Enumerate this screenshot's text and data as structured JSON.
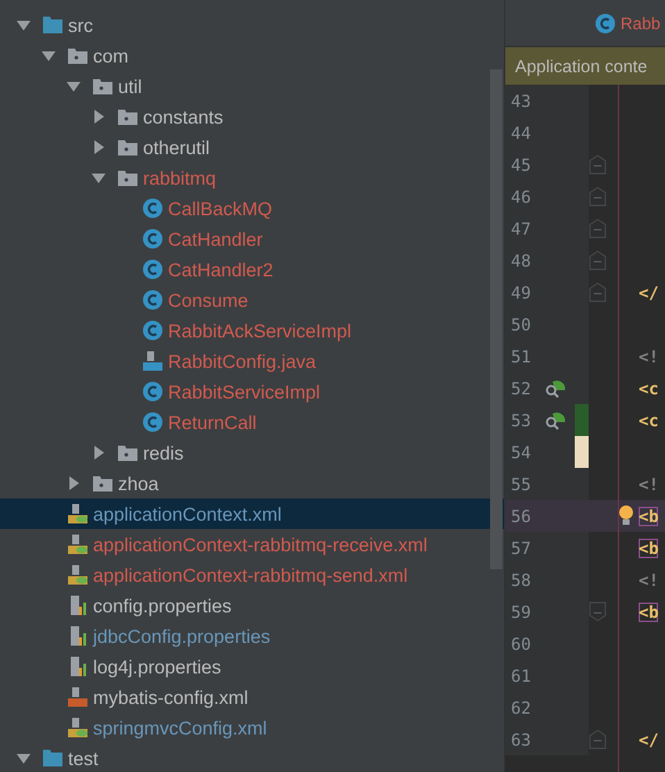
{
  "project_tree": [
    {
      "label": "src",
      "kind": "source-folder",
      "color": "#bbbbbb",
      "expanded": true,
      "selected": false,
      "children": [
        {
          "label": "com",
          "kind": "package",
          "color": "#bbbbbb",
          "expanded": true,
          "selected": false,
          "children": [
            {
              "label": "util",
              "kind": "package",
              "color": "#bbbbbb",
              "expanded": true,
              "selected": false,
              "children": [
                {
                  "label": "constants",
                  "kind": "package",
                  "color": "#bbbbbb",
                  "expanded": false,
                  "selected": false
                },
                {
                  "label": "otherutil",
                  "kind": "package",
                  "color": "#bbbbbb",
                  "expanded": false,
                  "selected": false
                },
                {
                  "label": "rabbitmq",
                  "kind": "package",
                  "color": "#d25a4f",
                  "expanded": true,
                  "selected": false,
                  "children": [
                    {
                      "label": "CallBackMQ",
                      "kind": "class",
                      "color": "#d25a4f",
                      "selected": false
                    },
                    {
                      "label": "CatHandler",
                      "kind": "class",
                      "color": "#d25a4f",
                      "selected": false
                    },
                    {
                      "label": "CatHandler2",
                      "kind": "class",
                      "color": "#d25a4f",
                      "selected": false
                    },
                    {
                      "label": "Consume",
                      "kind": "class",
                      "color": "#d25a4f",
                      "selected": false
                    },
                    {
                      "label": "RabbitAckServiceImpl",
                      "kind": "class",
                      "color": "#d25a4f",
                      "selected": false
                    },
                    {
                      "label": "RabbitConfig.java",
                      "kind": "java",
                      "color": "#d25a4f",
                      "selected": false
                    },
                    {
                      "label": "RabbitServiceImpl",
                      "kind": "class",
                      "color": "#d25a4f",
                      "selected": false
                    },
                    {
                      "label": "ReturnCall",
                      "kind": "class",
                      "color": "#d25a4f",
                      "selected": false
                    }
                  ]
                },
                {
                  "label": "redis",
                  "kind": "package",
                  "color": "#bbbbbb",
                  "expanded": false,
                  "selected": false
                }
              ]
            },
            {
              "label": "zhoa",
              "kind": "package",
              "color": "#bbbbbb",
              "expanded": false,
              "selected": false
            }
          ]
        },
        {
          "label": "applicationContext.xml",
          "kind": "spring-xml",
          "color": "#6897bb",
          "selected": true
        },
        {
          "label": "applicationContext-rabbitmq-receive.xml",
          "kind": "spring-xml",
          "color": "#d25a4f",
          "selected": false
        },
        {
          "label": "applicationContext-rabbitmq-send.xml",
          "kind": "spring-xml",
          "color": "#d25a4f",
          "selected": false
        },
        {
          "label": "config.properties",
          "kind": "properties",
          "color": "#bbbbbb",
          "selected": false
        },
        {
          "label": "jdbcConfig.properties",
          "kind": "properties",
          "color": "#6897bb",
          "selected": false
        },
        {
          "label": "log4j.properties",
          "kind": "properties",
          "color": "#bbbbbb",
          "selected": false
        },
        {
          "label": "mybatis-config.xml",
          "kind": "xml",
          "color": "#bbbbbb",
          "selected": false
        },
        {
          "label": "springmvcConfig.xml",
          "kind": "spring-xml",
          "color": "#6897bb",
          "selected": false
        }
      ]
    },
    {
      "label": "test",
      "kind": "source-folder",
      "color": "#bbbbbb",
      "expanded": true,
      "selected": false
    }
  ],
  "editor": {
    "tab": {
      "label": "Rabb",
      "color": "#d25a4f",
      "selected": true
    },
    "banner": "Application conte",
    "lines": [
      {
        "number": "43",
        "current": false
      },
      {
        "number": "44",
        "current": false
      },
      {
        "number": "45",
        "current": false,
        "fold_start": true
      },
      {
        "number": "46",
        "current": false,
        "fold_start": true
      },
      {
        "number": "47",
        "current": false,
        "fold_start": true
      },
      {
        "number": "48",
        "current": false,
        "fold_start": true
      },
      {
        "number": "49",
        "current": false,
        "fold_start": true,
        "code": {
          "text": "</",
          "color": "#e8bf6a",
          "highlighted": false
        }
      },
      {
        "number": "50",
        "current": false
      },
      {
        "number": "51",
        "current": false,
        "code": {
          "text": "<!",
          "color": "#808080",
          "highlighted": false
        }
      },
      {
        "number": "52",
        "current": false,
        "gutter_icon": true,
        "code": {
          "text": "<c",
          "color": "#e8bf6a",
          "highlighted": false
        }
      },
      {
        "number": "53",
        "current": false,
        "gutter_icon": true,
        "change_marker": {
          "color": "#295d29"
        },
        "code": {
          "text": "<c",
          "color": "#e8bf6a",
          "highlighted": false
        }
      },
      {
        "number": "54",
        "current": false,
        "change_marker": {
          "color": "#ebdcbd"
        }
      },
      {
        "number": "55",
        "current": false,
        "code": {
          "text": "<!",
          "color": "#808080",
          "highlighted": false
        }
      },
      {
        "number": "56",
        "current": true,
        "intention": true,
        "code": {
          "text": "<b",
          "color": "#e8bf6a",
          "highlighted": true
        }
      },
      {
        "number": "57",
        "current": false,
        "code": {
          "text": "<b",
          "color": "#e8bf6a",
          "highlighted": true
        }
      },
      {
        "number": "58",
        "current": false,
        "code": {
          "text": "<!",
          "color": "#808080",
          "highlighted": false
        }
      },
      {
        "number": "59",
        "current": false,
        "fold_end": true,
        "code": {
          "text": "<b",
          "color": "#e8bf6a",
          "highlighted": true
        }
      },
      {
        "number": "60",
        "current": false
      },
      {
        "number": "61",
        "current": false
      },
      {
        "number": "62",
        "current": false
      },
      {
        "number": "63",
        "current": false,
        "fold_start": true,
        "code": {
          "text": "</",
          "color": "#e8bf6a",
          "highlighted": false
        }
      }
    ]
  }
}
